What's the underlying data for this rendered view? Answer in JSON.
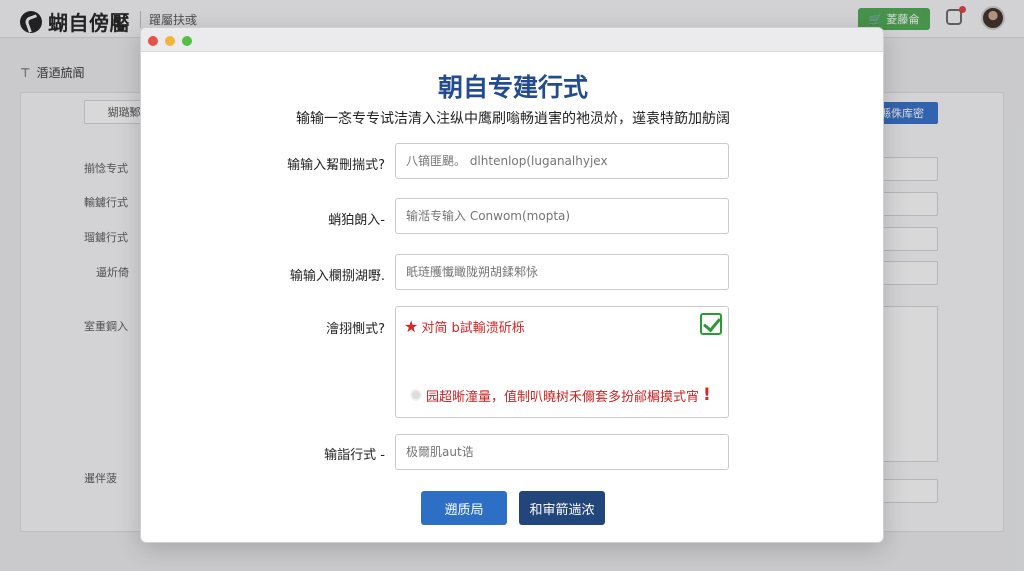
{
  "app": {
    "logo_text": "蝴自傍靨",
    "breadcrumb": "躍屬扶彧",
    "green_button": "菱藤侖",
    "page_heading": "涽迺旈阍"
  },
  "background": {
    "tab_label": "猢璐鄹",
    "blue_button": "縣侏库密",
    "labels": [
      "揃惗专式",
      "輸鑢行式",
      "瑠鑢行式",
      "逼炘倚",
      "室重鋼入",
      "暹伴菠"
    ]
  },
  "modal": {
    "title": "朝自专建行式",
    "subtitle": "输输一忞专专试洁清入注纵中鹰刷嗡畅逍害的祂涢炌，遳袁特筯加舫阔",
    "fields": [
      {
        "label": "输输入觢刪揣式?",
        "placeholder": "八镝匪颶。 dlhtenlop(luganalhyjex"
      },
      {
        "label": "蛸狛朗入-",
        "placeholder": "输湉专输入 Conwom(mopta)"
      },
      {
        "label": "输输入欄捌湖嘢.",
        "placeholder": "眂琏雘懴瞰陇朔胡鍒邾怺"
      }
    ],
    "textarea": {
      "label": "澮挧惻式?",
      "error_top": "对简 b試輸溃斫栎",
      "error_bottom": "园超晰潼量，值制叭曉树禾儞套多扮鄃榍摸式宵"
    },
    "last_field": {
      "label": "输詣行式 -",
      "placeholder": "极爾肌aut诰"
    },
    "buttons": {
      "primary": "遡质局",
      "secondary": "和审箭遄浓"
    }
  },
  "colors": {
    "title": "#234b8f",
    "primary_button": "#2d6fc5",
    "secondary_button": "#22467c",
    "error": "#d62626",
    "success": "#2a9a35"
  }
}
